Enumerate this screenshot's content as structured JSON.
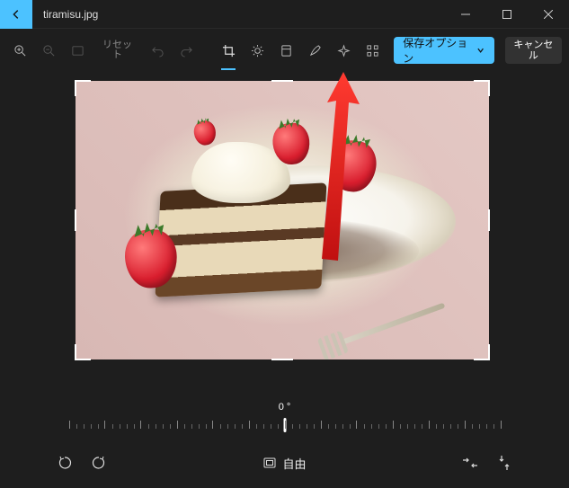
{
  "titlebar": {
    "filename": "tiramisu.jpg"
  },
  "toolbar": {
    "reset_label": "リセット",
    "save_label": "保存オプション",
    "cancel_label": "キャンセル"
  },
  "rotation": {
    "angle_label": "0 °"
  },
  "bottombar": {
    "aspect_label": "自由"
  },
  "icons": {
    "back": "←",
    "minimize": "—",
    "maximize": "▢",
    "close": "✕"
  }
}
